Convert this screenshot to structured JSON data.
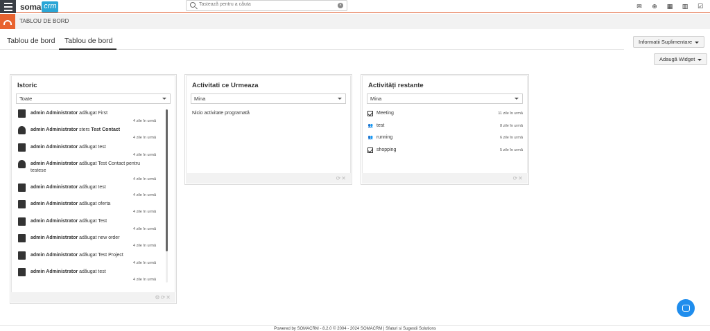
{
  "header": {
    "logo_soma": "soma",
    "logo_crm": "crm",
    "search_placeholder": "Tastează pentru a căuta",
    "icons": [
      "envelope-icon",
      "plus-circle-icon",
      "calendar-icon",
      "bar-chart-icon",
      "checkbox-icon"
    ]
  },
  "module": {
    "title": "TABLOU DE BORD",
    "accent": "#e8632f"
  },
  "tabs": [
    {
      "label": "Tablou de bord",
      "active": false
    },
    {
      "label": "Tablou de bord",
      "active": true
    }
  ],
  "buttons": {
    "info": "Informatii Suplimentare",
    "add_widget": "Adaugă Widget"
  },
  "widgets": {
    "istoric": {
      "title": "Istoric",
      "filter": "Toate",
      "items": [
        {
          "icon": "invoice-icon",
          "user": "admin Administrator",
          "action": "adăugat",
          "object": "First",
          "object_bold": false,
          "time": "4 zile în urmă"
        },
        {
          "icon": "contact-icon",
          "user": "admin Administrator",
          "action": "sters",
          "object": "Test Contact",
          "object_bold": true,
          "time": "4 zile în urmă"
        },
        {
          "icon": "document-icon",
          "user": "admin Administrator",
          "action": "adăugat",
          "object": "test",
          "object_bold": false,
          "time": "4 zile în urmă"
        },
        {
          "icon": "money-bag-icon",
          "user": "admin Administrator",
          "action": "adăugat",
          "object": "Test Contact pentru testese",
          "object_bold": false,
          "time": "4 zile în urmă"
        },
        {
          "icon": "sales-order-icon",
          "user": "admin Administrator",
          "action": "adăugat",
          "object": "test",
          "object_bold": false,
          "time": "4 zile în urmă"
        },
        {
          "icon": "quote-icon",
          "user": "admin Administrator",
          "action": "adăugat",
          "object": "oferta",
          "object_bold": false,
          "time": "4 zile în urmă"
        },
        {
          "icon": "building-icon",
          "user": "admin Administrator",
          "action": "adăugat",
          "object": "Test",
          "object_bold": false,
          "time": "4 zile în urmă"
        },
        {
          "icon": "purchase-order-icon",
          "user": "admin Administrator",
          "action": "adăugat",
          "object": "new order",
          "object_bold": false,
          "time": "4 zile în urmă"
        },
        {
          "icon": "briefcase-icon",
          "user": "admin Administrator",
          "action": "adăugat",
          "object": "Test Project",
          "object_bold": false,
          "time": "4 zile în urmă"
        },
        {
          "icon": "handshake-icon",
          "user": "admin Administrator",
          "action": "adăugat",
          "object": "test",
          "object_bold": false,
          "time": "4 zile în urmă"
        }
      ]
    },
    "urmeaza": {
      "title": "Activitati ce Urmeaza",
      "filter": "Mina",
      "empty": "Nicio activitate programată"
    },
    "restante": {
      "title": "Activități restante",
      "filter": "Mina",
      "items": [
        {
          "icon": "task-check-icon",
          "label": "Meeting",
          "time": "11 zile în urmă"
        },
        {
          "icon": "meeting-people-icon",
          "label": "test",
          "time": "8 zile în urmă"
        },
        {
          "icon": "meeting-people-icon",
          "label": "running",
          "time": "6 zile în urmă"
        },
        {
          "icon": "task-check-icon",
          "label": "shopping",
          "time": "5 zile în urmă"
        }
      ]
    }
  },
  "footer": {
    "text": "Powered by SOMACRM - 8.2.0 © 2004 - 2024 SOMACRM | Sfaturi si Sugestii Solutions"
  }
}
